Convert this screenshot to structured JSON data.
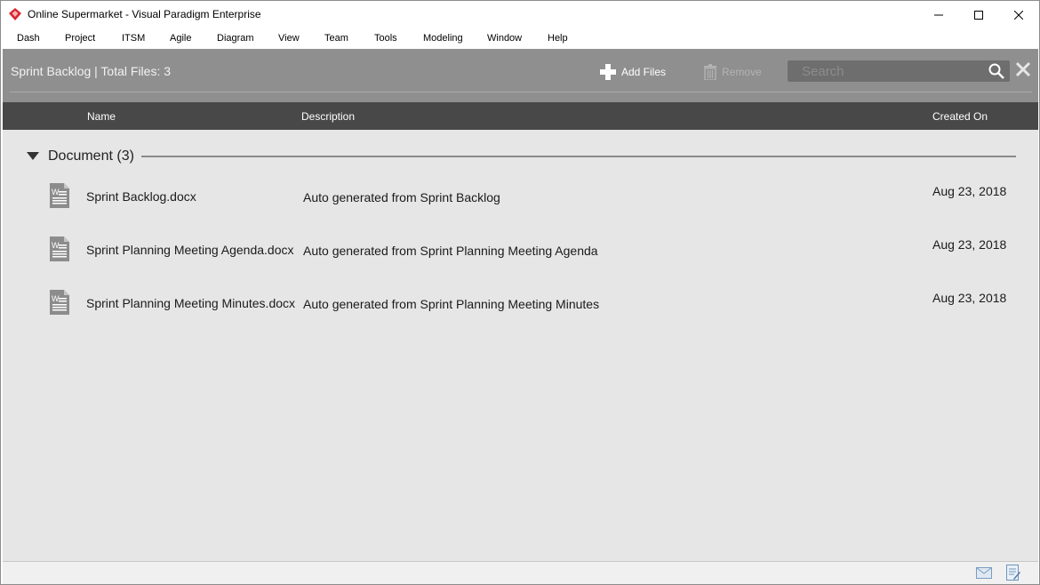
{
  "window": {
    "title": "Online Supermarket - Visual Paradigm Enterprise",
    "controls": [
      "minimize",
      "maximize",
      "close"
    ]
  },
  "menu": {
    "items": [
      "Dash",
      "Project",
      "ITSM",
      "Agile",
      "Diagram",
      "View",
      "Team",
      "Tools",
      "Modeling",
      "Window",
      "Help"
    ]
  },
  "header": {
    "title": "Sprint Backlog | Total Files: 3",
    "add_files_label": "Add Files",
    "remove_label": "Remove",
    "search_placeholder": "Search",
    "search_value": ""
  },
  "columns": {
    "name": "Name",
    "description": "Description",
    "created_on": "Created On"
  },
  "group": {
    "label": "Document (3)",
    "expanded": true
  },
  "files": [
    {
      "name": "Sprint Backlog.docx",
      "description": "Auto generated from Sprint Backlog",
      "created_on": "Aug 23, 2018",
      "icon": "word-document-icon"
    },
    {
      "name": "Sprint Planning Meeting Agenda.docx",
      "description": "Auto generated from Sprint Planning Meeting Agenda",
      "created_on": "Aug 23, 2018",
      "icon": "word-document-icon"
    },
    {
      "name": "Sprint Planning Meeting Minutes.docx",
      "description": "Auto generated from Sprint Planning Meeting Minutes",
      "created_on": "Aug 23, 2018",
      "icon": "word-document-icon"
    }
  ],
  "statusbar": {
    "icons": [
      "mail-icon",
      "notes-icon"
    ]
  },
  "colors": {
    "header_bg": "#8f8f8f",
    "column_header_bg": "#484848",
    "content_bg": "#e6e6e6",
    "search_bg": "#6e6e6e",
    "brand_red": "#d9252c"
  }
}
